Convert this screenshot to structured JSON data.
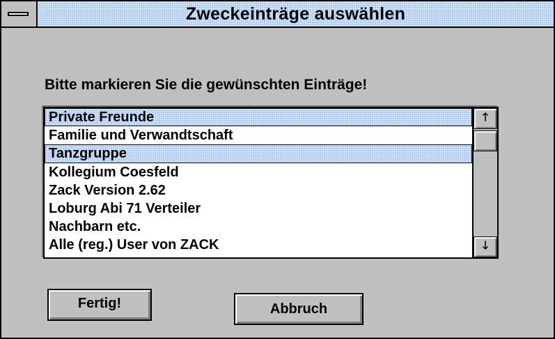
{
  "window": {
    "title": "Zweckeinträge auswählen",
    "system_menu_icon": "minus-bar-icon"
  },
  "instruction": "Bitte markieren Sie die gewünschten Einträge!",
  "listbox": {
    "items": [
      {
        "label": "Private Freunde",
        "selected": true
      },
      {
        "label": "Familie und Verwandtschaft",
        "selected": false
      },
      {
        "label": "Tanzgruppe",
        "selected": true
      },
      {
        "label": "Kollegium Coesfeld",
        "selected": false
      },
      {
        "label": "Zack Version 2.62",
        "selected": false
      },
      {
        "label": "Loburg Abi 71 Verteiler",
        "selected": false
      },
      {
        "label": "Nachbarn etc.",
        "selected": false
      },
      {
        "label": "Alle (reg.) User von ZACK",
        "selected": false
      }
    ],
    "scroll_up_icon": "arrow-up-icon",
    "scroll_down_icon": "arrow-down-icon"
  },
  "buttons": {
    "ok_label": "Fertig!",
    "cancel_label": "Abbruch"
  },
  "colors": {
    "selection": "#a6c8f2",
    "face": "#c0c0c0"
  }
}
